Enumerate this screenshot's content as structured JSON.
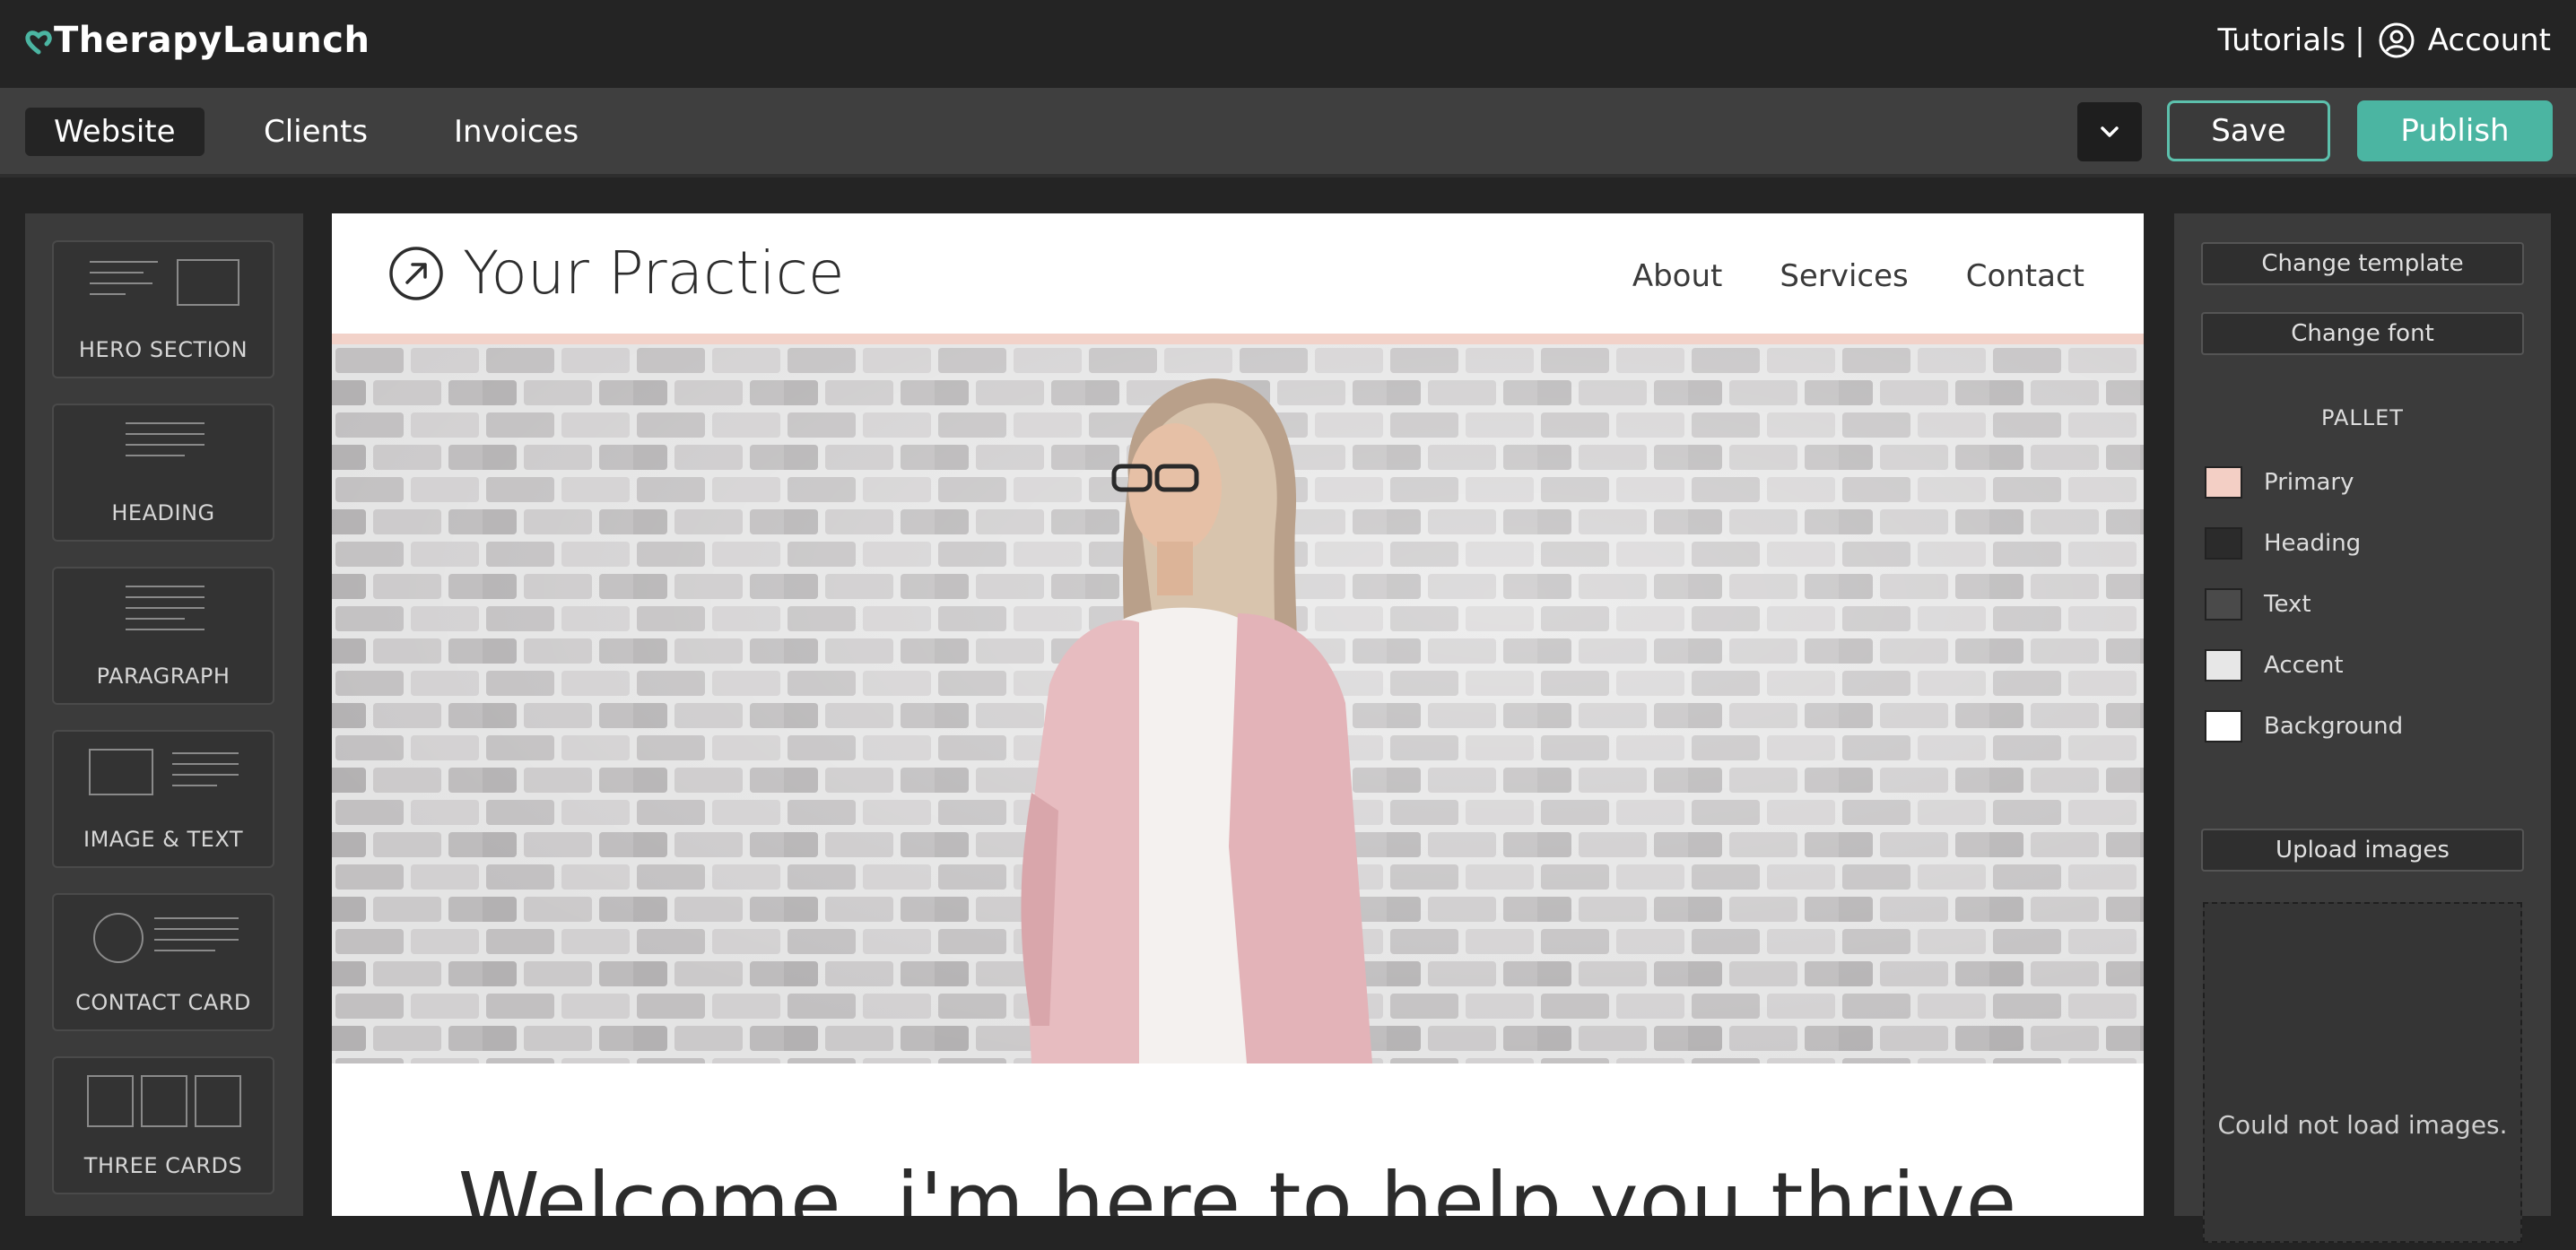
{
  "app": {
    "brand": "TherapyLaunch",
    "tutorials_label": "Tutorials",
    "separator": "|",
    "account_label": "Account"
  },
  "toolbar": {
    "tabs": [
      {
        "label": "Website",
        "active": true
      },
      {
        "label": "Clients",
        "active": false
      },
      {
        "label": "Invoices",
        "active": false
      }
    ],
    "save_label": "Save",
    "publish_label": "Publish"
  },
  "blocks": [
    {
      "label": "HERO SECTION",
      "icon": "hero-section-icon"
    },
    {
      "label": "HEADING",
      "icon": "heading-icon"
    },
    {
      "label": "PARAGRAPH",
      "icon": "paragraph-icon"
    },
    {
      "label": "IMAGE & TEXT",
      "icon": "image-text-icon"
    },
    {
      "label": "CONTACT CARD",
      "icon": "contact-card-icon"
    },
    {
      "label": "THREE CARDS",
      "icon": "three-cards-icon"
    }
  ],
  "site": {
    "title": "Your Practice",
    "nav": [
      "About",
      "Services",
      "Contact"
    ],
    "welcome": "Welcome, i'm here to help you thrive"
  },
  "panel": {
    "change_template": "Change template",
    "change_font": "Change font",
    "pallet_title": "PALLET",
    "pallet": [
      {
        "label": "Primary",
        "color": "#f3cfc5"
      },
      {
        "label": "Heading",
        "color": "#2b2b2b"
      },
      {
        "label": "Text",
        "color": "#4a4a4a"
      },
      {
        "label": "Accent",
        "color": "#e7e7e7"
      },
      {
        "label": "Background",
        "color": "#ffffff"
      }
    ],
    "upload_label": "Upload images",
    "load_error": "Could not load images."
  },
  "colors": {
    "accent": "#4bb5a2",
    "brand_icon": "#4bb5a2"
  }
}
